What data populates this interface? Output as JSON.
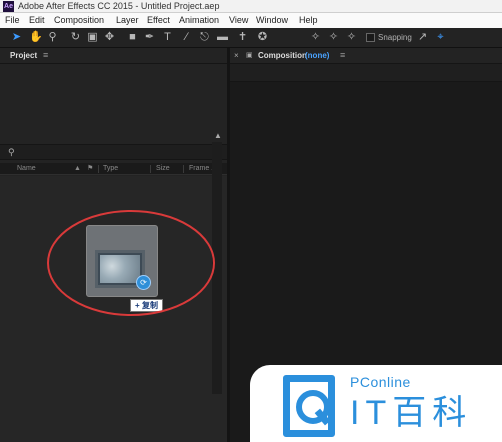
{
  "window": {
    "title": "Adobe After Effects CC 2015 - Untitled Project.aep",
    "app_icon": "Ae"
  },
  "menubar": {
    "items": [
      "File",
      "Edit",
      "Composition",
      "Layer",
      "Effect",
      "Animation",
      "View",
      "Window",
      "Help"
    ]
  },
  "toolbar": {
    "tools": [
      "selection-tool-icon",
      "hand-tool-icon",
      "zoom-tool-icon",
      "rotation-tool-icon",
      "camera-tool-icon",
      "pan-behind-tool-icon",
      "rectangle-tool-icon",
      "pen-tool-icon",
      "type-tool-icon",
      "brush-tool-icon",
      "clone-stamp-tool-icon",
      "eraser-tool-icon",
      "roto-brush-tool-icon",
      "puppet-pin-tool-icon",
      "local-axis-icon",
      "world-axis-icon",
      "view-axis-icon"
    ],
    "snapping_label": "Snapping"
  },
  "project_panel": {
    "title": "Project",
    "menu_glyph": "≡",
    "search_placeholder": "",
    "columns": [
      "Name",
      "Type",
      "Size",
      "Frame ..."
    ]
  },
  "drag": {
    "tooltip": "+ 复制"
  },
  "composition_panel": {
    "title": "Composition",
    "comp_name": "(none)",
    "menu_glyph": "≡"
  },
  "watermark": {
    "brand": "PConline",
    "name": "IT百科"
  },
  "colors": {
    "accent": "#3d9bff",
    "highlight_ellipse": "#d93a3a",
    "watermark_blue": "#2b8fdc"
  }
}
